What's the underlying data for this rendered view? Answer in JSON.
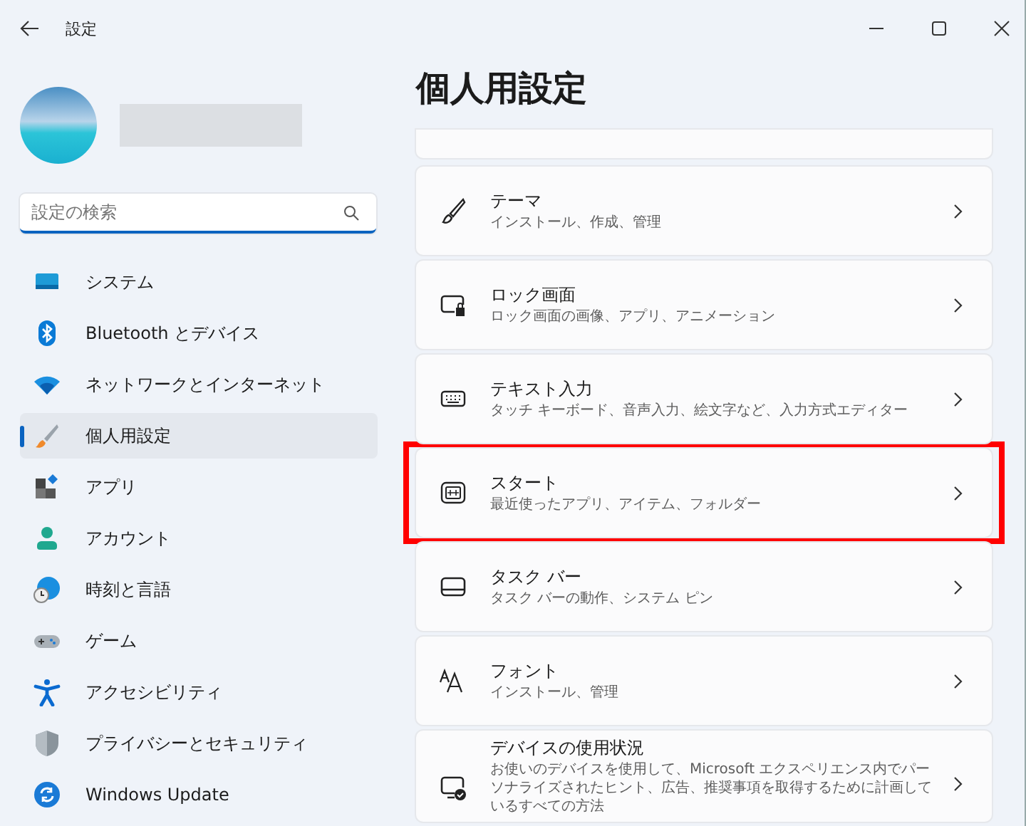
{
  "window": {
    "title": "設定"
  },
  "search": {
    "placeholder": "設定の検索"
  },
  "sidebar": {
    "items": [
      {
        "label": "システム",
        "kind": "system",
        "selected": false
      },
      {
        "label": "Bluetooth とデバイス",
        "kind": "bluetooth",
        "selected": false
      },
      {
        "label": "ネットワークとインターネット",
        "kind": "network",
        "selected": false
      },
      {
        "label": "個人用設定",
        "kind": "personalization",
        "selected": true
      },
      {
        "label": "アプリ",
        "kind": "apps",
        "selected": false
      },
      {
        "label": "アカウント",
        "kind": "accounts",
        "selected": false
      },
      {
        "label": "時刻と言語",
        "kind": "time",
        "selected": false
      },
      {
        "label": "ゲーム",
        "kind": "gaming",
        "selected": false
      },
      {
        "label": "アクセシビリティ",
        "kind": "accessibility",
        "selected": false
      },
      {
        "label": "プライバシーとセキュリティ",
        "kind": "privacy",
        "selected": false
      },
      {
        "label": "Windows Update",
        "kind": "update",
        "selected": false
      }
    ]
  },
  "page": {
    "title": "個人用設定",
    "cards": [
      {
        "kind": "theme",
        "title": "テーマ",
        "subtitle": "インストール、作成、管理",
        "highlighted": false
      },
      {
        "kind": "lock",
        "title": "ロック画面",
        "subtitle": "ロック画面の画像、アプリ、アニメーション",
        "highlighted": false
      },
      {
        "kind": "keyboard",
        "title": "テキスト入力",
        "subtitle": "タッチ キーボード、音声入力、絵文字など、入力方式エディター",
        "highlighted": false
      },
      {
        "kind": "start",
        "title": "スタート",
        "subtitle": "最近使ったアプリ、アイテム、フォルダー",
        "highlighted": true
      },
      {
        "kind": "taskbar",
        "title": "タスク バー",
        "subtitle": "タスク バーの動作、システム ピン",
        "highlighted": false
      },
      {
        "kind": "font",
        "title": "フォント",
        "subtitle": "インストール、管理",
        "highlighted": false
      },
      {
        "kind": "device",
        "title": "デバイスの使用状況",
        "subtitle": "お使いのデバイスを使用して、Microsoft エクスペリエンス内でパーソナライズされたヒント、広告、推奨事項を取得するために計画しているすべての方法",
        "highlighted": false
      }
    ]
  }
}
